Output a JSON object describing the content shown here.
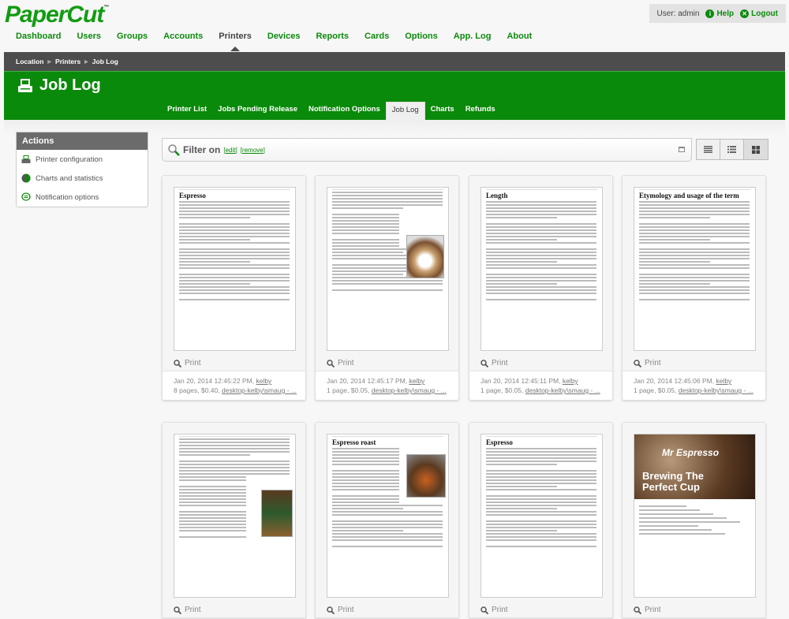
{
  "app": {
    "logo": "PaperCut",
    "tm": "™"
  },
  "user_box": {
    "user_label": "User: admin",
    "help": "Help",
    "logout": "Logout"
  },
  "main_nav": [
    "Dashboard",
    "Users",
    "Groups",
    "Accounts",
    "Printers",
    "Devices",
    "Reports",
    "Cards",
    "Options",
    "App. Log",
    "About"
  ],
  "main_nav_active": "Printers",
  "breadcrumb": [
    "Location",
    "Printers",
    "Job Log"
  ],
  "page_title": "Job Log",
  "sub_nav": [
    "Printer List",
    "Jobs Pending Release",
    "Notification Options",
    "Job Log",
    "Charts",
    "Refunds"
  ],
  "sub_nav_active": "Job Log",
  "actions": {
    "title": "Actions",
    "items": [
      {
        "label": "Printer configuration",
        "icon": "printer-icon"
      },
      {
        "label": "Charts and statistics",
        "icon": "pie-chart-icon"
      },
      {
        "label": "Notification options",
        "icon": "speech-bubble-icon"
      }
    ]
  },
  "filter": {
    "label": "Filter on",
    "edit": "[edit]",
    "remove": "[remove]"
  },
  "view_modes": [
    "list-view",
    "detail-view",
    "grid-view"
  ],
  "cards": [
    {
      "title": "Espresso",
      "action": "Print",
      "datetime": "Jan 20, 2014 12:45:22 PM",
      "user": "kelby",
      "pages": "8 pages",
      "cost": "$0.40",
      "printer": "desktop-kelby\\smaug - ..."
    },
    {
      "title": "",
      "action": "Print",
      "datetime": "Jan 20, 2014 12:45:17 PM",
      "user": "kelby",
      "pages": "1 page",
      "cost": "$0.05",
      "printer": "desktop-kelby\\smaug - ..."
    },
    {
      "title": "Length",
      "action": "Print",
      "datetime": "Jan 20, 2014 12:45:11 PM",
      "user": "kelby",
      "pages": "1 page",
      "cost": "$0.05",
      "printer": "desktop-kelby\\smaug - ..."
    },
    {
      "title": "Etymology and usage of the term",
      "action": "Print",
      "datetime": "Jan 20, 2014 12:45:06 PM",
      "user": "kelby",
      "pages": "1 page",
      "cost": "$0.05",
      "printer": "desktop-kelby\\smaug - ..."
    },
    {
      "title": "",
      "action": "Print"
    },
    {
      "title": "Espresso roast",
      "action": "Print"
    },
    {
      "title": "Espresso",
      "action": "Print"
    },
    {
      "title": "Brewing The Perfect Cup",
      "subtitle": "Mr Espresso",
      "action": "Print"
    }
  ]
}
